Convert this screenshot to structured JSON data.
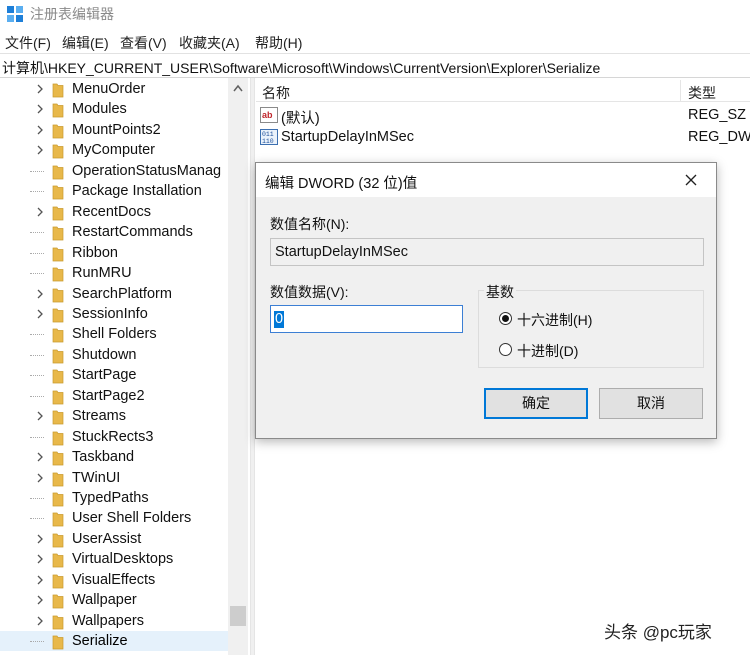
{
  "window": {
    "title": "注册表编辑器",
    "icon": "registry-editor-icon"
  },
  "menu": [
    {
      "label": "文件(F)"
    },
    {
      "label": "编辑(E)"
    },
    {
      "label": "查看(V)"
    },
    {
      "label": "收藏夹(A)"
    },
    {
      "label": "帮助(H)"
    }
  ],
  "address": {
    "path": "计算机\\HKEY_CURRENT_USER\\Software\\Microsoft\\Windows\\CurrentVersion\\Explorer\\Serialize"
  },
  "tree": {
    "items": [
      {
        "label": "MenuOrder",
        "expandable": true
      },
      {
        "label": "Modules",
        "expandable": true
      },
      {
        "label": "MountPoints2",
        "expandable": true
      },
      {
        "label": "MyComputer",
        "expandable": true
      },
      {
        "label": "OperationStatusManag",
        "expandable": false
      },
      {
        "label": "Package Installation",
        "expandable": false
      },
      {
        "label": "RecentDocs",
        "expandable": true
      },
      {
        "label": "RestartCommands",
        "expandable": false
      },
      {
        "label": "Ribbon",
        "expandable": false
      },
      {
        "label": "RunMRU",
        "expandable": false
      },
      {
        "label": "SearchPlatform",
        "expandable": true
      },
      {
        "label": "SessionInfo",
        "expandable": true
      },
      {
        "label": "Shell Folders",
        "expandable": false
      },
      {
        "label": "Shutdown",
        "expandable": false
      },
      {
        "label": "StartPage",
        "expandable": false
      },
      {
        "label": "StartPage2",
        "expandable": false
      },
      {
        "label": "Streams",
        "expandable": true
      },
      {
        "label": "StuckRects3",
        "expandable": false
      },
      {
        "label": "Taskband",
        "expandable": true
      },
      {
        "label": "TWinUI",
        "expandable": true
      },
      {
        "label": "TypedPaths",
        "expandable": false
      },
      {
        "label": "User Shell Folders",
        "expandable": false
      },
      {
        "label": "UserAssist",
        "expandable": true
      },
      {
        "label": "VirtualDesktops",
        "expandable": true
      },
      {
        "label": "VisualEffects",
        "expandable": true
      },
      {
        "label": "Wallpaper",
        "expandable": true
      },
      {
        "label": "Wallpapers",
        "expandable": true
      },
      {
        "label": "Serialize",
        "expandable": false,
        "selected": true
      }
    ]
  },
  "list": {
    "columns": {
      "name": "名称",
      "type": "类型"
    },
    "rows": [
      {
        "name": "(默认)",
        "type": "REG_SZ",
        "icon": "string-value-icon"
      },
      {
        "name": "StartupDelayInMSec",
        "type": "REG_DWO",
        "icon": "dword-value-icon"
      }
    ]
  },
  "dialog": {
    "title": "编辑 DWORD (32 位)值",
    "name_label": "数值名称(N):",
    "name_value": "StartupDelayInMSec",
    "data_label": "数值数据(V):",
    "data_value": "0",
    "base_label": "基数",
    "hex_label": "十六进制(H)",
    "dec_label": "十进制(D)",
    "selected_base": "hex",
    "ok_label": "确定",
    "cancel_label": "取消"
  },
  "watermark": "头条 @pc玩家",
  "colors": {
    "accent": "#0078d7",
    "folder": "#e8b84a",
    "dialog_bg": "#f0f0f0"
  }
}
